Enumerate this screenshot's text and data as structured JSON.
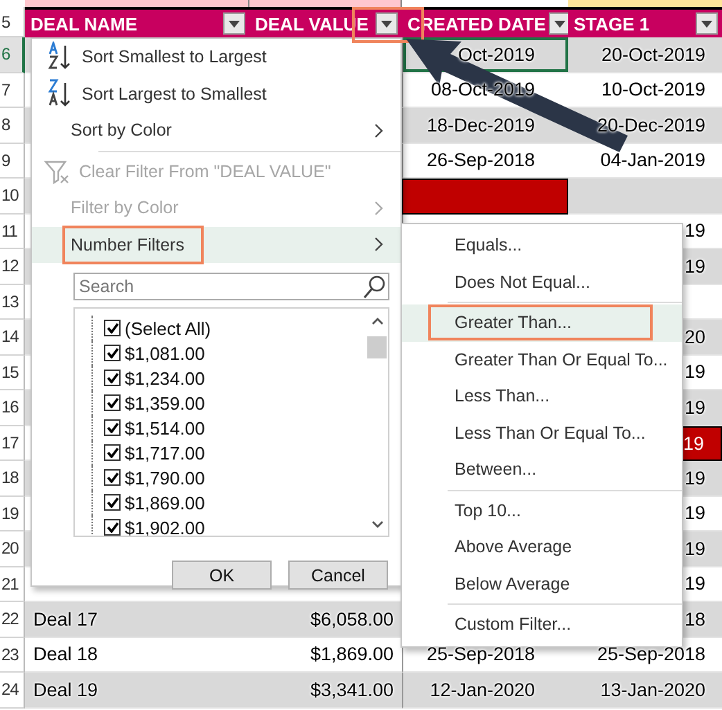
{
  "sheet": {
    "header_row_number": "5",
    "columns": [
      {
        "label": "DEAL NAME",
        "outlined": false
      },
      {
        "label": "DEAL VALUE",
        "outlined": true
      },
      {
        "label": "CREATED DATE",
        "outlined": false
      },
      {
        "label": "STAGE 1",
        "outlined": false
      }
    ],
    "rows": [
      {
        "number": "6",
        "selected": true,
        "created_red": false,
        "stage_red": false,
        "created_date": "Oct-2019",
        "stage_1": "20-Oct-2019"
      },
      {
        "number": "7",
        "selected": false,
        "created_red": false,
        "stage_red": false,
        "created_date": "08-Oct-2019",
        "stage_1": "10-Oct-2019"
      },
      {
        "number": "8",
        "selected": false,
        "created_red": false,
        "stage_red": false,
        "created_date": "18-Dec-2019",
        "stage_1": "20-Dec-2019"
      },
      {
        "number": "9",
        "selected": false,
        "created_red": false,
        "stage_red": false,
        "created_date": "26-Sep-2018",
        "stage_1": "04-Jan-2019"
      },
      {
        "number": "10",
        "selected": false,
        "created_red": true,
        "stage_red": false
      },
      {
        "number": "11",
        "selected": false,
        "stage_red": false,
        "stage_1": "19"
      },
      {
        "number": "12",
        "selected": false,
        "stage_red": false,
        "stage_1": "19"
      },
      {
        "number": "13",
        "selected": false,
        "stage_red": false
      },
      {
        "number": "14",
        "selected": false,
        "stage_red": false,
        "stage_1": "20"
      },
      {
        "number": "15",
        "selected": false,
        "stage_red": false,
        "stage_1": "19"
      },
      {
        "number": "16",
        "selected": false,
        "stage_red": false,
        "stage_1": "19"
      },
      {
        "number": "17",
        "selected": false,
        "stage_red": true,
        "stage_1": "19"
      },
      {
        "number": "18",
        "selected": false,
        "stage_red": false,
        "stage_1": "19"
      },
      {
        "number": "19",
        "selected": false,
        "stage_red": false,
        "stage_1": "19"
      },
      {
        "number": "20",
        "selected": false,
        "stage_red": false,
        "stage_1": "19"
      },
      {
        "number": "21",
        "selected": false,
        "stage_red": false,
        "stage_1": "19"
      },
      {
        "number": "22",
        "selected": false,
        "stage_red": false,
        "deal_name": "Deal 17",
        "deal_value": "$6,058.00",
        "stage_1": "18"
      },
      {
        "number": "23",
        "selected": false,
        "created_red": false,
        "stage_red": false,
        "deal_name": "Deal 18",
        "deal_value": "$1,869.00",
        "created_date": "25-Sep-2018",
        "stage_1": "25-Sep-2018"
      },
      {
        "number": "24",
        "selected": false,
        "created_red": false,
        "stage_red": false,
        "deal_name": "Deal 19",
        "deal_value": "$3,341.00",
        "created_date": "12-Jan-2020",
        "stage_1": "13-Jan-2020"
      }
    ]
  },
  "filter_menu": {
    "items": [
      {
        "kind": "sort_ascending",
        "label": "Sort Smallest to Largest",
        "disabled": false,
        "submenu": false,
        "selected": false,
        "outlined": false
      },
      {
        "kind": "sort_descending",
        "label": "Sort Largest to Smallest",
        "disabled": false,
        "submenu": false,
        "selected": false,
        "outlined": false
      },
      {
        "kind": "plain",
        "label": "Sort by Color",
        "disabled": false,
        "submenu": true,
        "selected": false,
        "outlined": false
      },
      {
        "kind": "separator"
      },
      {
        "kind": "clear",
        "label": "Clear Filter From \"DEAL VALUE\"",
        "disabled": true,
        "submenu": false,
        "selected": false,
        "outlined": false
      },
      {
        "kind": "plain",
        "label": "Filter by Color",
        "disabled": true,
        "submenu": true,
        "selected": false,
        "outlined": false
      },
      {
        "kind": "plain",
        "label": "Number Filters",
        "disabled": false,
        "submenu": true,
        "selected": true,
        "outlined": true
      }
    ],
    "search": {
      "placeholder": "Search"
    },
    "values": [
      {
        "label": "(Select All)",
        "checked": true
      },
      {
        "label": "$1,081.00",
        "checked": true
      },
      {
        "label": "$1,234.00",
        "checked": true
      },
      {
        "label": "$1,359.00",
        "checked": true
      },
      {
        "label": "$1,514.00",
        "checked": true
      },
      {
        "label": "$1,717.00",
        "checked": true
      },
      {
        "label": "$1,790.00",
        "checked": true
      },
      {
        "label": "$1,869.00",
        "checked": true
      },
      {
        "label": "$1,902.00",
        "checked": true
      }
    ],
    "buttons": [
      "OK",
      "Cancel"
    ]
  },
  "number_filters_menu": {
    "items": [
      {
        "kind": "item",
        "label": "Equals...",
        "selected": false,
        "outlined": false
      },
      {
        "kind": "item",
        "label": "Does Not Equal...",
        "selected": false,
        "outlined": false
      },
      {
        "kind": "separator"
      },
      {
        "kind": "item",
        "label": "Greater Than...",
        "selected": true,
        "outlined": true
      },
      {
        "kind": "item",
        "label": "Greater Than Or Equal To...",
        "selected": false,
        "outlined": false
      },
      {
        "kind": "item",
        "label": "Less Than...",
        "selected": false,
        "outlined": false
      },
      {
        "kind": "item",
        "label": "Less Than Or Equal To...",
        "selected": false,
        "outlined": false
      },
      {
        "kind": "item",
        "label": "Between...",
        "selected": false,
        "outlined": false
      },
      {
        "kind": "separator"
      },
      {
        "kind": "item",
        "label": "Top 10...",
        "selected": false,
        "outlined": false
      },
      {
        "kind": "item",
        "label": "Above Average",
        "selected": false,
        "outlined": false
      },
      {
        "kind": "item",
        "label": "Below Average",
        "selected": false,
        "outlined": false
      },
      {
        "kind": "separator"
      },
      {
        "kind": "item",
        "label": "Custom Filter...",
        "selected": false,
        "outlined": false
      }
    ]
  }
}
